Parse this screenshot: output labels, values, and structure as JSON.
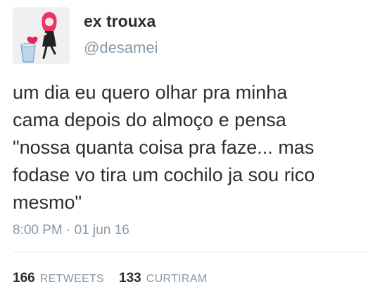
{
  "user": {
    "display_name": "ex trouxa",
    "handle": "@desamei",
    "avatar_icon": "cartoon-girl-with-heart-and-glass-icon"
  },
  "tweet": {
    "text_lines": [
      "um dia eu quero olhar pra minha",
      "cama depois do almoço e pensa",
      "\"nossa quanta coisa pra faze... mas",
      "fodase vo tira um cochilo ja sou rico",
      "mesmo\""
    ],
    "timestamp": "8:00 PM · 01 jun 16"
  },
  "stats": {
    "retweets_count": "166",
    "retweets_label": "RETWEETS",
    "likes_count": "133",
    "likes_label": "CURTIRAM"
  },
  "colors": {
    "text": "#292f33",
    "secondary": "#8899a6",
    "divider": "#e1e8ed",
    "heart": "#e0245e"
  }
}
